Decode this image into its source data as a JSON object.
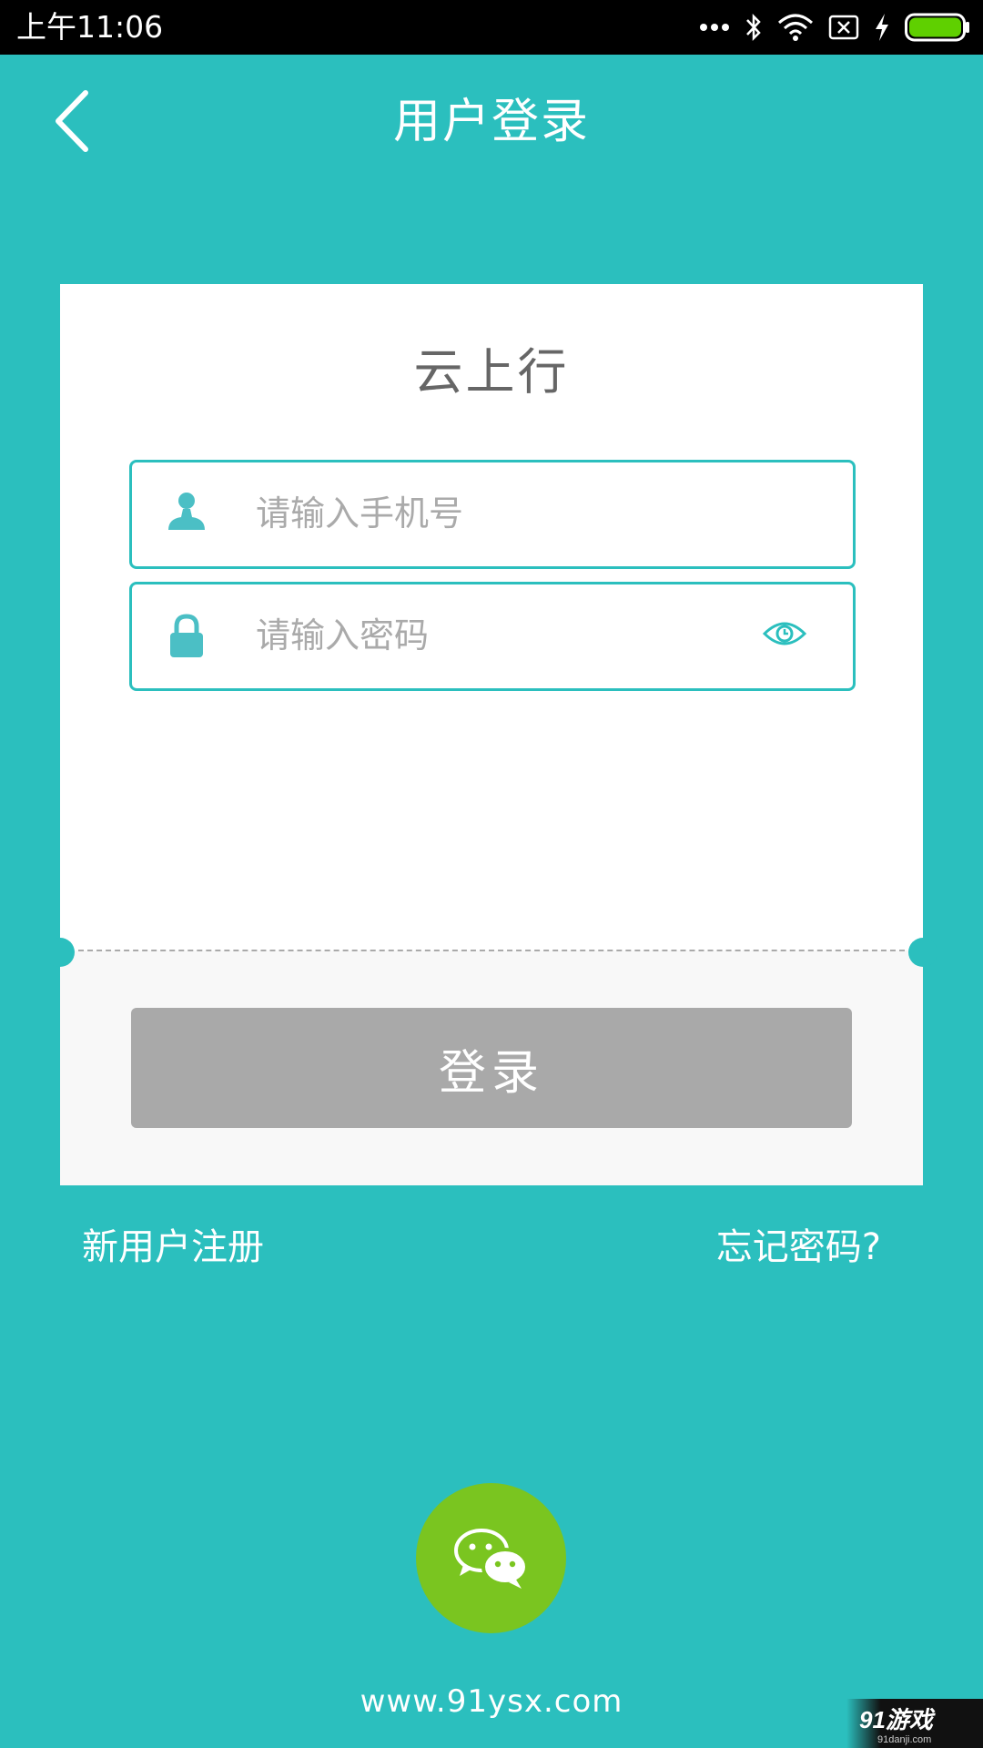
{
  "status_bar": {
    "time": "上午11:06",
    "icons": [
      "dots-icon",
      "bluetooth-icon",
      "wifi-icon",
      "no-sim-icon",
      "charging-icon",
      "battery-icon"
    ],
    "battery_color": "#5fd000"
  },
  "header": {
    "title": "用户登录",
    "back_icon": "chevron-left-icon"
  },
  "card": {
    "brand": "云上行",
    "phone_field": {
      "placeholder": "请输入手机号",
      "value": "",
      "icon": "user-icon"
    },
    "password_field": {
      "placeholder": "请输入密码",
      "value": "",
      "icon": "lock-icon",
      "toggle_icon": "eye-icon"
    },
    "login_label": "登录"
  },
  "links": {
    "register": "新用户注册",
    "forgot": "忘记密码?"
  },
  "social": {
    "icon": "wechat-icon"
  },
  "footer": {
    "url": "www.91ysx.com"
  },
  "watermark": {
    "brand": "91游戏",
    "site": "91danji.com"
  },
  "colors": {
    "background": "#2bbfbe",
    "login_button": "#a9a9a9",
    "wechat": "#7ac520",
    "placeholder": "#aaaaaa",
    "brand_text": "#666666"
  }
}
